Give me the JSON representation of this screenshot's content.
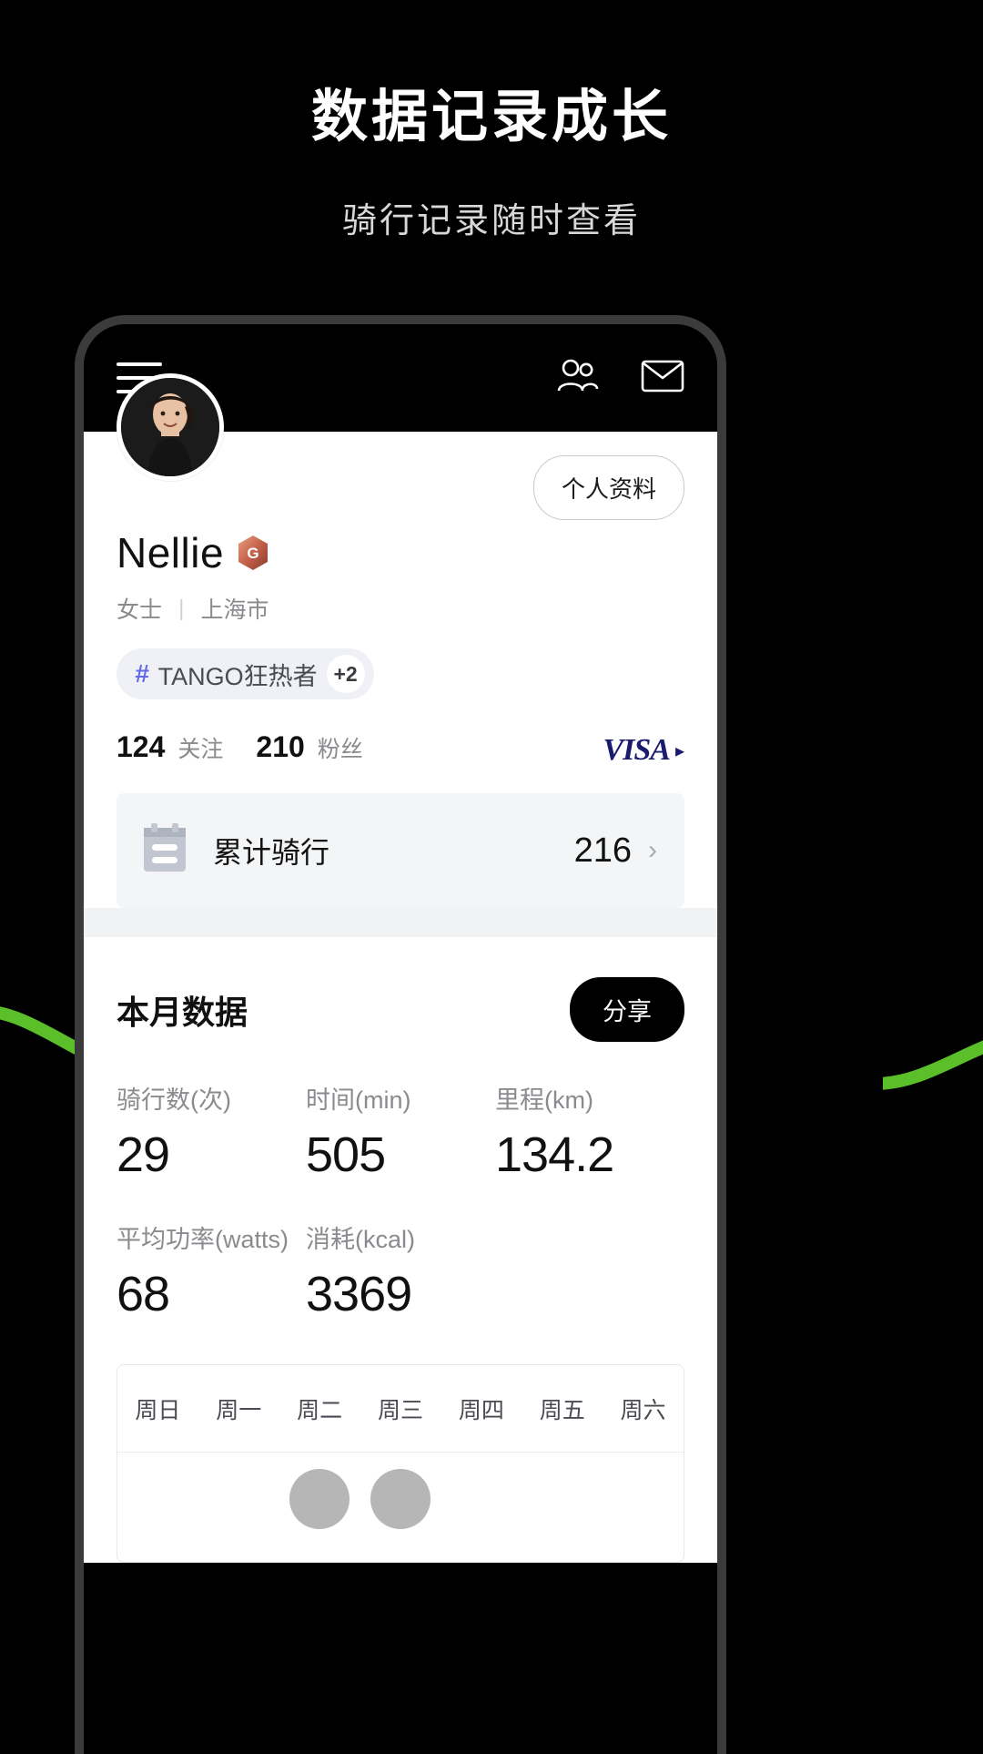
{
  "promo": {
    "title": "数据记录成长",
    "subtitle": "骑行记录随时查看"
  },
  "colors": {
    "background": "#000000",
    "frame_border": "#3b3b3b",
    "accent_green": "#5bbf2a",
    "tag_bg": "#f0f1f6",
    "tag_hash": "#6369e8",
    "visa_blue": "#1a1a6e",
    "card_bg": "#f4f5f7",
    "muted_text": "#8a8a8f",
    "dot_gray": "#b6b6b6"
  },
  "app": {
    "topbar": {
      "menu_icon": "hamburger-icon",
      "contacts_icon": "people-icon",
      "mail_icon": "envelope-icon"
    },
    "profile": {
      "avatar": "user-avatar-photo",
      "profile_button": "个人资料",
      "name": "Nellie",
      "badge_icon": "gold-hexagon-g-badge",
      "badge_letter": "G",
      "gender": "女士",
      "separator": "|",
      "city": "上海市",
      "tag": {
        "hash": "#",
        "label": "TANGO狂热者",
        "more": "+2"
      },
      "following_count": "124",
      "following_label": "关注",
      "followers_count": "210",
      "followers_label": "粉丝",
      "visa_text": "VISA",
      "visa_arrow": "▸"
    },
    "accumulated": {
      "icon": "calendar-icon",
      "label": "累计骑行",
      "value": "216",
      "chevron": "›"
    },
    "month": {
      "title": "本月数据",
      "share_label": "分享",
      "stats": [
        {
          "label": "骑行数(次)",
          "value": "29"
        },
        {
          "label": "时间(min)",
          "value": "505"
        },
        {
          "label": "里程(km)",
          "value": "134.2"
        },
        {
          "label": "平均功率(watts)",
          "value": "68"
        },
        {
          "label": "消耗(kcal)",
          "value": "3369"
        }
      ]
    },
    "week_chart": {
      "days": [
        "周日",
        "周一",
        "周二",
        "周三",
        "周四",
        "周五",
        "周六"
      ],
      "dots": [
        false,
        false,
        true,
        true,
        false,
        false,
        false
      ]
    }
  },
  "chart_data": {
    "type": "bar",
    "title": "本月数据",
    "categories": [
      "周日",
      "周一",
      "周二",
      "周三",
      "周四",
      "周五",
      "周六"
    ],
    "values": [
      0,
      0,
      1,
      1,
      0,
      0,
      0
    ],
    "xlabel": "",
    "ylabel": "",
    "legend": []
  }
}
